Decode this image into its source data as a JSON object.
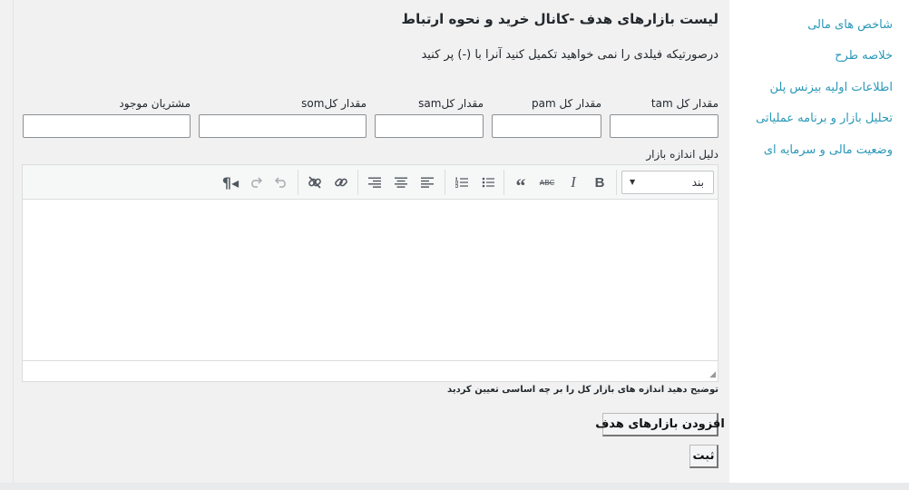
{
  "sidebar": {
    "items": [
      {
        "label": "شاخص های مالی"
      },
      {
        "label": "خلاصه طرح"
      },
      {
        "label": "اطلاعات اولیه بیزنس پلن"
      },
      {
        "label": "تحلیل بازار و برنامه عملیاتی"
      },
      {
        "label": "وضعیت مالی و سرمایه ای"
      }
    ],
    "link_color": "#2a98b8"
  },
  "main": {
    "title": "لیست بازارهای هدف -کانال خرید و نحوه ارتباط",
    "subtitle": "درصورتیکه فیلدی را نمی خواهید تکمیل کنید آنرا با (-) پر کنید",
    "fields": [
      {
        "label": "مقدار کل tam",
        "value": ""
      },
      {
        "label": "مقدار کل pam",
        "value": ""
      },
      {
        "label": "مقدار کلsam",
        "value": ""
      },
      {
        "label": "مقدار کلsom",
        "value": ""
      },
      {
        "label": "مشتریان موجود",
        "value": ""
      }
    ],
    "editor": {
      "label": "دلیل اندازه بازار",
      "format_select": "بند",
      "content": "",
      "toolbar_icons": [
        "bold-icon",
        "italic-icon",
        "strikethrough-icon",
        "blockquote-icon",
        "bullet-list-icon",
        "numbered-list-icon",
        "align-left-icon",
        "align-center-icon",
        "align-right-icon",
        "link-icon",
        "unlink-icon",
        "undo-icon",
        "redo-icon",
        "rtl-direction-icon"
      ]
    },
    "hint": "توضیح دهید اندازه های بازار کل را بر چه اساسی تعیین کردید",
    "add_button": "افزودن بازارهای هدف",
    "submit_button": "ثبت"
  }
}
